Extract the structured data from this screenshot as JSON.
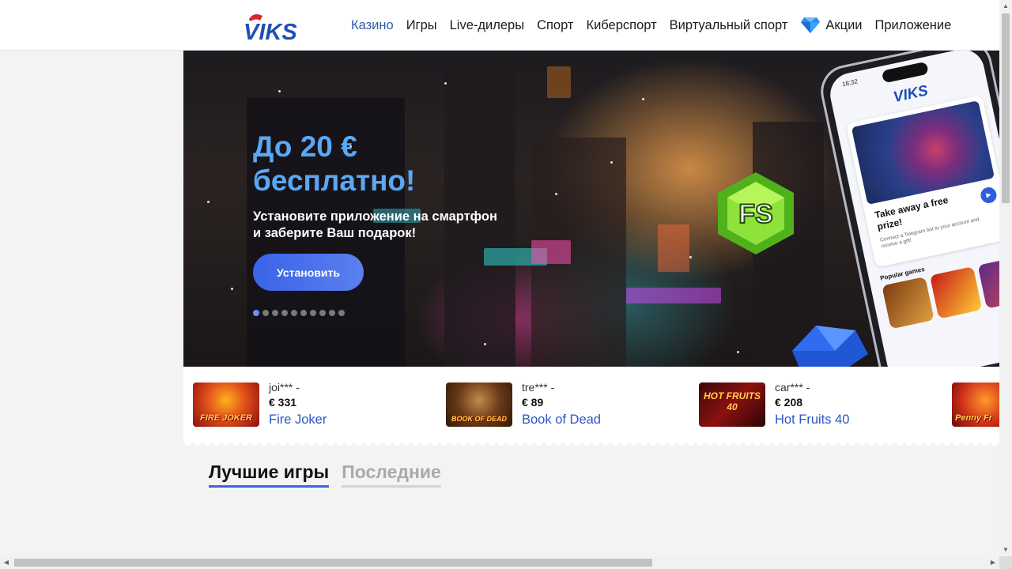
{
  "header": {
    "logo_text": "VIKS",
    "nav": [
      {
        "label": "Казино",
        "active": true
      },
      {
        "label": "Игры"
      },
      {
        "label": "Live-дилеры"
      },
      {
        "label": "Спорт"
      },
      {
        "label": "Киберспорт"
      },
      {
        "label": "Виртуальный спорт"
      },
      {
        "label": "Акции",
        "icon": "diamond-icon"
      },
      {
        "label": "Приложение"
      }
    ]
  },
  "banner": {
    "title_line1": "До 20 €",
    "title_line2": "бесплатно!",
    "subtitle": "Установите приложение на смартфон и заберите Ваш подарок!",
    "button_label": "Установить",
    "slides_count": 10,
    "active_slide": 1,
    "phone": {
      "time": "18:32",
      "logo": "VIKS",
      "card_title": "Take away a free prize!",
      "card_text": "Connect a Telegram bot to your account and receive a gift!",
      "popular_label": "Popular games"
    },
    "gem_label": "FS"
  },
  "winners": [
    {
      "user": "joi*** -",
      "amount": "€ 331",
      "game": "Fire Joker",
      "thumb_text": "FIRE JOKER"
    },
    {
      "user": "tre*** -",
      "amount": "€ 89",
      "game": "Book of Dead",
      "thumb_text": "BOOK OF DEAD"
    },
    {
      "user": "car*** -",
      "amount": "€ 208",
      "game": "Hot Fruits 40",
      "thumb_text": "HOT FRUITS 40"
    },
    {
      "user": "",
      "amount": "",
      "game": "",
      "thumb_text": "Penny Fr"
    }
  ],
  "tabs": [
    {
      "label": "Лучшие игры",
      "active": true
    },
    {
      "label": "Последние",
      "active": false
    }
  ],
  "colors": {
    "accent": "#3a63e6",
    "link": "#2b56c7",
    "banner_title": "#5aa8f5"
  }
}
